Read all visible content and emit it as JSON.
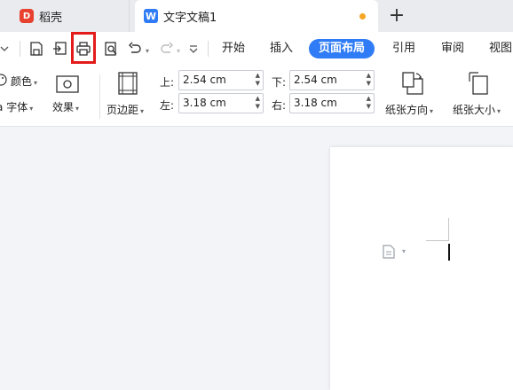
{
  "tabs": {
    "app_tab": {
      "label": "稻壳",
      "logo": "D"
    },
    "doc_tab": {
      "label": "文字文稿1",
      "logo": "W"
    },
    "new_tab_label": "+"
  },
  "ribbon_tabs": [
    "开始",
    "插入",
    "页面布局",
    "引用",
    "审阅",
    "视图"
  ],
  "active_ribbon_tab": "页面布局",
  "quick_toolbar_icons": [
    "chevron-down-icon",
    "save-icon",
    "export-icon",
    "print-icon",
    "print-preview-icon",
    "undo-icon",
    "redo-icon",
    "customize-icon"
  ],
  "ribbon": {
    "color_label": "颜色",
    "font_label": "字体",
    "font_prefix": "a",
    "effect_label": "效果",
    "margins_label": "页边距",
    "margins": {
      "top_label": "上:",
      "top_value": "2.54 cm",
      "bottom_label": "下:",
      "bottom_value": "2.54 cm",
      "left_label": "左:",
      "left_value": "3.18 cm",
      "right_label": "右:",
      "right_value": "3.18 cm"
    },
    "orientation_label": "纸张方向",
    "size_label": "纸张大小"
  },
  "colors": {
    "accent": "#2f7cf6",
    "highlight": "#e31b1b",
    "unsaved_dot": "#f5a623",
    "app_logo": "#e8412f"
  }
}
